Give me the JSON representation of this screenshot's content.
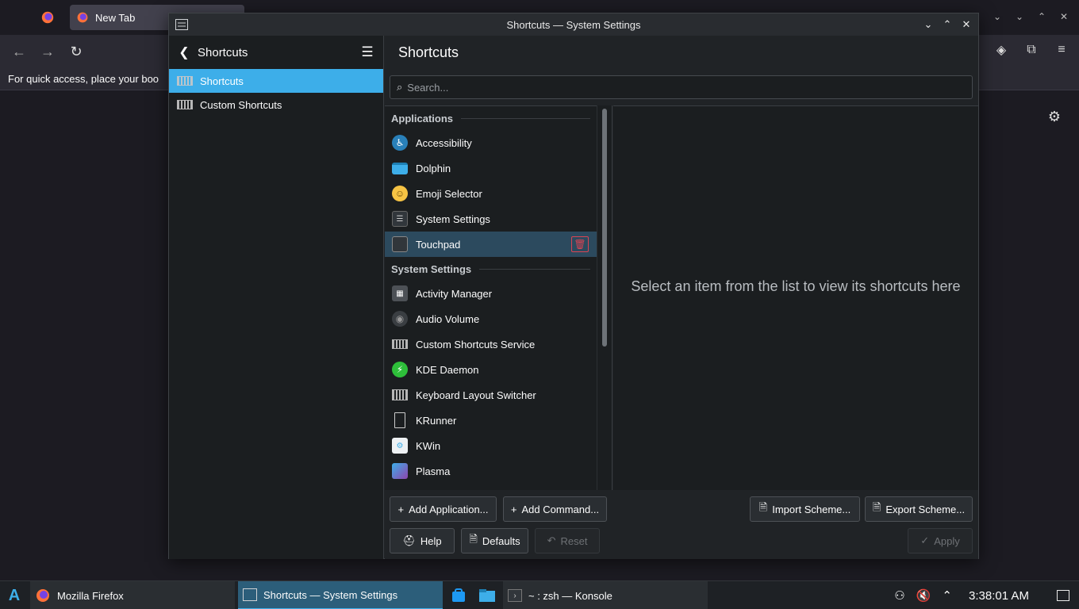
{
  "firefox": {
    "tab_title": "New Tab",
    "bookmarks_hint": "For quick access, place your boo"
  },
  "window": {
    "title": "Shortcuts — System Settings"
  },
  "sidebar": {
    "title": "Shortcuts",
    "items": [
      {
        "label": "Shortcuts",
        "icon": "keyboard-icon",
        "active": true
      },
      {
        "label": "Custom Shortcuts",
        "icon": "keyboard-icon",
        "active": false
      }
    ]
  },
  "main": {
    "title": "Shortcuts",
    "search_placeholder": "Search...",
    "sections": [
      {
        "header": "Applications",
        "items": [
          {
            "label": "Accessibility",
            "icon": "accessibility-icon"
          },
          {
            "label": "Dolphin",
            "icon": "folder-icon"
          },
          {
            "label": "Emoji Selector",
            "icon": "emoji-icon"
          },
          {
            "label": "System Settings",
            "icon": "system-settings-icon"
          },
          {
            "label": "Touchpad",
            "icon": "touchpad-icon",
            "selected": true
          }
        ]
      },
      {
        "header": "System Settings",
        "items": [
          {
            "label": "Activity Manager",
            "icon": "activity-manager-icon"
          },
          {
            "label": "Audio Volume",
            "icon": "speaker-icon"
          },
          {
            "label": "Custom Shortcuts Service",
            "icon": "keyboard-icon"
          },
          {
            "label": "KDE Daemon",
            "icon": "kde-daemon-icon"
          },
          {
            "label": "Keyboard Layout Switcher",
            "icon": "keyboard-layout-icon"
          },
          {
            "label": "KRunner",
            "icon": "document-icon"
          },
          {
            "label": "KWin",
            "icon": "kwin-icon"
          },
          {
            "label": "Plasma",
            "icon": "plasma-icon"
          }
        ]
      }
    ],
    "empty_detail": "Select an item from the list to view its shortcuts here",
    "buttons": {
      "add_application": "Add Application...",
      "add_command": "Add Command...",
      "import_scheme": "Import Scheme...",
      "export_scheme": "Export Scheme...",
      "help": "Help",
      "defaults": "Defaults",
      "reset": "Reset",
      "apply": "Apply"
    }
  },
  "taskbar": {
    "tasks": [
      {
        "label": "Mozilla Firefox"
      },
      {
        "label": "Shortcuts  — System Settings",
        "active": true
      },
      {
        "label": "~ : zsh — Konsole"
      }
    ],
    "clock": "3:38:01 AM"
  },
  "colors": {
    "accent": "#3daee9",
    "window_bg": "#202326",
    "view_bg": "#1b1e20",
    "selection": "#2c4a5e",
    "danger": "#da4453"
  }
}
